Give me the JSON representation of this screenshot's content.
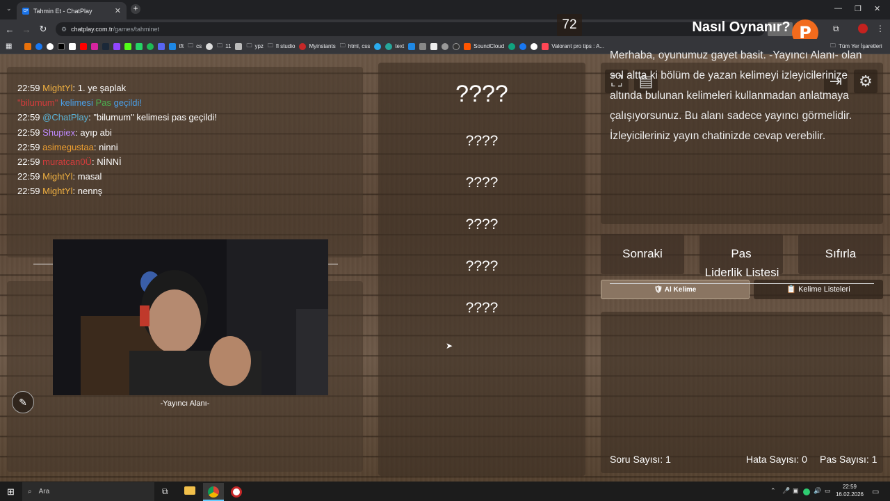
{
  "browser": {
    "tab_title": "Tahmin Et - ChatPlay",
    "tab_favicon": "CP",
    "url_host": "chatplay.com.tr",
    "url_path": "/games/tahminet",
    "bookmarks": [
      "tft",
      "cs",
      "11",
      "ypz",
      "fl studio",
      "Myinstants",
      "html, css",
      "text",
      "SoundCloud",
      "Valorant pro tips : A..."
    ],
    "all_bookmarks": "Tüm Yer İşaretleri"
  },
  "chat": {
    "messages": [
      {
        "time": "22:59",
        "user": "MightYl",
        "text": ": 1. ye şaplak",
        "color": "u1"
      },
      {
        "time": "",
        "user": "\"bilumum\"",
        "text": "",
        "color": "u2",
        "extra": [
          {
            "t": " kelimesi ",
            "c": "bl"
          },
          {
            "t": "Pas",
            "c": "gr"
          },
          {
            "t": " geçildi!",
            "c": "bl"
          }
        ]
      },
      {
        "time": "22:59",
        "user": "@ChatPlay",
        "text": ": \"bilumum\" kelimesi pas geçildi!",
        "color": "u3"
      },
      {
        "time": "22:59",
        "user": "Shupiex",
        "text": ": ayıp abi",
        "color": "u4"
      },
      {
        "time": "22:59",
        "user": "asimegustaa",
        "text": ": ninni",
        "color": "u5"
      },
      {
        "time": "22:59",
        "user": "muratcan0Ü",
        "text": ": NİNNİ",
        "color": "u2"
      },
      {
        "time": "22:59",
        "user": "MightYl",
        "text": ": masal",
        "color": "u1"
      },
      {
        "time": "22:59",
        "user": "MightYl",
        "text": ": nennş",
        "color": "u1"
      }
    ]
  },
  "stream": {
    "label": "-Yayıncı Alanı-"
  },
  "words": {
    "timer": "72",
    "main": "????",
    "hidden": [
      "????",
      "????",
      "????",
      "????",
      "????"
    ]
  },
  "how": {
    "title": "Nasıl Oynanır?",
    "text": "Merhaba, oyunumuz gayet basit. -Yayıncı Alanı- olan sol altta ki bölüm de yazan kelimeyi izleyicilerinize altında bulunan kelimeleri kullanmadan anlatmaya çalışıyorsunuz. Bu alanı sadece yayıncı görmelidir. İzleyicileriniz yayın chatinizde cevap verebilir."
  },
  "controls": {
    "next": "Sonraki",
    "pass": "Pas",
    "reset": "Sıfırla",
    "ai_word": "Al Kelime",
    "word_lists": "Kelime Listeleri"
  },
  "board": {
    "title": "Liderlik Listesi",
    "questions": "Soru Sayısı: 1",
    "errors": "Hata Sayısı: 0",
    "passes": "Pas Sayısı: 1"
  },
  "taskbar": {
    "search": "Ara",
    "time": "22:59",
    "date": "16.02.2026"
  }
}
